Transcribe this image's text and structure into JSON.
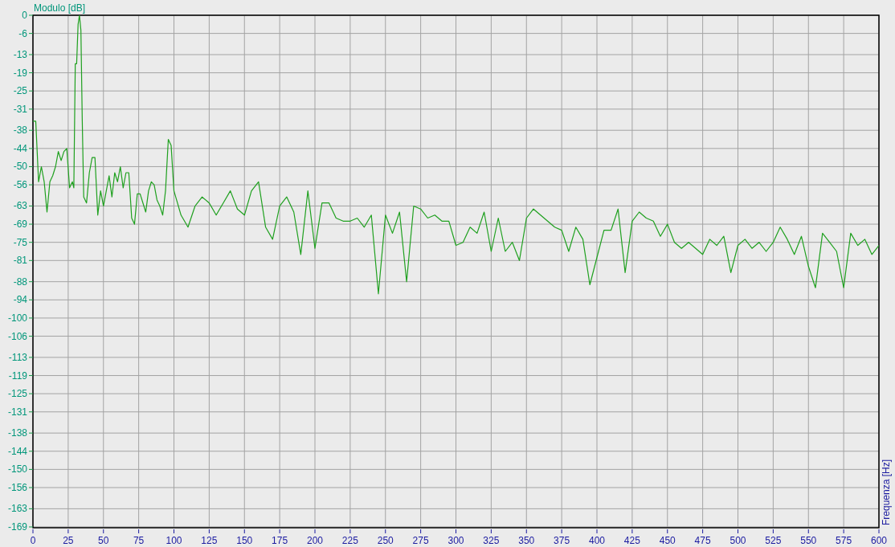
{
  "chart_data": {
    "type": "line",
    "grid": true,
    "annotations": [
      {
        "text": "Frequenza [Hz]"
      }
    ],
    "ylabel": "Modulo [dB]",
    "x": [
      0,
      2,
      4,
      6,
      8,
      10,
      12,
      14,
      16,
      18,
      20,
      22,
      24,
      26,
      28,
      29,
      30,
      31,
      32,
      33,
      34,
      35,
      36,
      38,
      40,
      42,
      44,
      46,
      48,
      50,
      52,
      54,
      56,
      58,
      60,
      62,
      64,
      66,
      68,
      70,
      72,
      74,
      76,
      78,
      80,
      82,
      84,
      86,
      88,
      90,
      92,
      94,
      96,
      97,
      98,
      100,
      105,
      110,
      115,
      120,
      125,
      130,
      135,
      140,
      145,
      150,
      155,
      160,
      165,
      170,
      175,
      180,
      185,
      190,
      195,
      200,
      205,
      210,
      215,
      220,
      225,
      230,
      235,
      240,
      245,
      250,
      255,
      260,
      265,
      270,
      275,
      280,
      285,
      290,
      295,
      300,
      305,
      310,
      315,
      320,
      325,
      330,
      335,
      340,
      345,
      350,
      355,
      360,
      365,
      370,
      375,
      380,
      385,
      390,
      395,
      400,
      405,
      410,
      415,
      420,
      425,
      430,
      435,
      440,
      445,
      450,
      455,
      460,
      465,
      470,
      475,
      480,
      485,
      490,
      495,
      500,
      505,
      510,
      515,
      520,
      525,
      530,
      535,
      540,
      545,
      550,
      555,
      560,
      565,
      570,
      575,
      580,
      585,
      590,
      595,
      600
    ],
    "series": [
      {
        "color": "#1fa01f",
        "values": [
          -35,
          -35,
          -55,
          -50,
          -55,
          -65,
          -55,
          -53,
          -50,
          -45,
          -48,
          -45,
          -44,
          -57,
          -55,
          -57,
          -16,
          -16,
          -3,
          0,
          -5,
          -35,
          -60,
          -62,
          -52,
          -47,
          -47,
          -66,
          -58,
          -63,
          -58,
          -53,
          -60,
          -52,
          -55,
          -50,
          -57,
          -52,
          -52,
          -67,
          -69,
          -59,
          -59,
          -62,
          -65,
          -58,
          -55,
          -56,
          -61,
          -63,
          -66,
          -58,
          -41,
          -42,
          -43,
          -58,
          -66,
          -70,
          -63,
          -60,
          -62,
          -66,
          -62,
          -58,
          -64,
          -66,
          -58,
          -55,
          -70,
          -74,
          -63,
          -60,
          -65,
          -79,
          -58,
          -77,
          -62,
          -62,
          -67,
          -68,
          -68,
          -67,
          -70,
          -66,
          -92,
          -66,
          -72,
          -65,
          -88,
          -63,
          -64,
          -67,
          -66,
          -68,
          -68,
          -76,
          -75,
          -70,
          -72,
          -65,
          -78,
          -67,
          -78,
          -75,
          -81,
          -67,
          -64,
          -66,
          -68,
          -70,
          -71,
          -78,
          -70,
          -74,
          -89,
          -80,
          -71,
          -71,
          -64,
          -85,
          -68,
          -65,
          -67,
          -68,
          -73,
          -69,
          -75,
          -77,
          -75,
          -77,
          -79,
          -74,
          -76,
          -73,
          -85,
          -76,
          -74,
          -77,
          -75,
          -78,
          -75,
          -70,
          -74,
          -79,
          -73,
          -83,
          -90,
          -72,
          -75,
          -78,
          -90,
          -72,
          -76,
          -74,
          -79,
          -76
        ]
      }
    ],
    "xlim": [
      0,
      600
    ],
    "ylim": [
      -169,
      0
    ],
    "xticks": [
      0,
      25,
      50,
      75,
      100,
      125,
      150,
      175,
      200,
      225,
      250,
      275,
      300,
      325,
      350,
      375,
      400,
      425,
      450,
      475,
      500,
      525,
      550,
      575,
      600
    ],
    "yticks": [
      0,
      -6,
      -13,
      -19,
      -25,
      -31,
      -38,
      -44,
      -50,
      -56,
      -63,
      -69,
      -75,
      -81,
      -88,
      -94,
      -100,
      -106,
      -113,
      -119,
      -125,
      -131,
      -138,
      -144,
      -150,
      -156,
      -163,
      -169
    ]
  }
}
